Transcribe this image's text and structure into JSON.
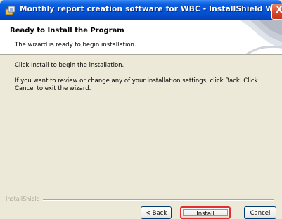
{
  "window": {
    "title": "Monthly report creation software for WBC - InstallShield Wizard",
    "close_symbol": "X",
    "icon": "installer-icon"
  },
  "header": {
    "title": "Ready to Install the Program",
    "subtitle": "The wizard is ready to begin installation."
  },
  "body": {
    "line1": "Click Install to begin the installation.",
    "line2": "If you want to review or change any of your installation settings, click Back. Click Cancel to exit the wizard."
  },
  "footer": {
    "brand": "InstallShield"
  },
  "buttons": {
    "back": "< Back",
    "install": "Install",
    "cancel": "Cancel"
  },
  "colors": {
    "titlebar": "#0553d6",
    "dialog_bg": "#ece9d8",
    "highlight": "#e03030"
  }
}
